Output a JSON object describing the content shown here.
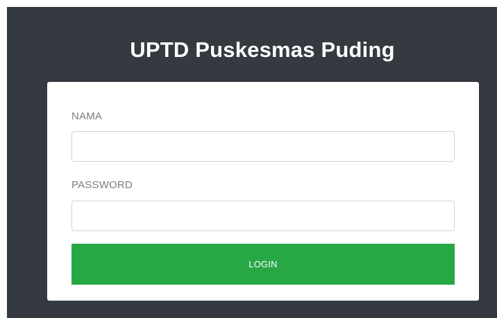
{
  "page": {
    "title": "UPTD Puskesmas Puding"
  },
  "form": {
    "nama_label": "NAMA",
    "nama_value": "",
    "nama_placeholder": "",
    "password_label": "PASSWORD",
    "password_value": "",
    "password_placeholder": "",
    "login_label": "LOGIN"
  },
  "colors": {
    "background": "#343a40",
    "card": "#ffffff",
    "accent": "#28a745"
  }
}
